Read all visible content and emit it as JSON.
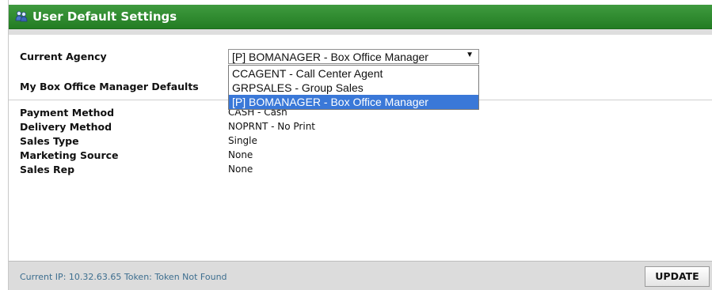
{
  "header": {
    "title": "User Default Settings",
    "icon": "users-icon"
  },
  "form": {
    "agency_label": "Current Agency",
    "agency_selected": "[P] BOMANAGER - Box Office Manager",
    "agency_options": [
      "CCAGENT - Call Center Agent",
      "GRPSALES - Group Sales",
      "[P] BOMANAGER - Box Office Manager"
    ],
    "defaults_heading": "My Box Office Manager Defaults"
  },
  "defaults": [
    {
      "label": "Payment Method",
      "value": "CASH - Cash"
    },
    {
      "label": "Delivery Method",
      "value": "NOPRNT - No Print"
    },
    {
      "label": "Sales Type",
      "value": "Single"
    },
    {
      "label": "Marketing Source",
      "value": "None"
    },
    {
      "label": "Sales Rep",
      "value": "None"
    }
  ],
  "footer": {
    "info": "Current IP: 10.32.63.65  Token: Token Not Found",
    "update_label": "UPDATE"
  },
  "colors": {
    "header_green": "#2e8b2e",
    "selection_blue": "#3a78d8"
  }
}
